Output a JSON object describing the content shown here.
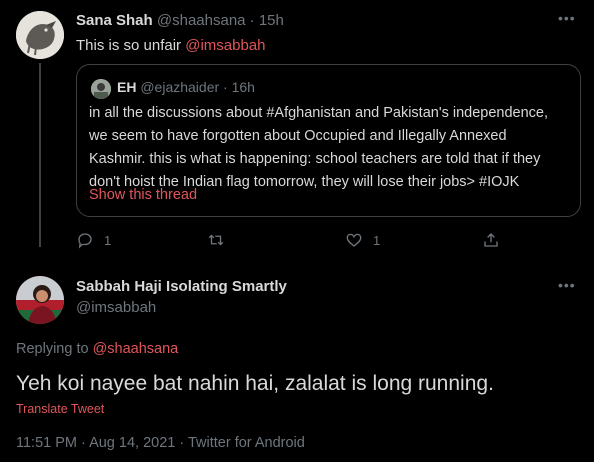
{
  "parent_tweet": {
    "author_name": "Sana Shah",
    "author_handle": "@shaahsana",
    "separator": "·",
    "time": "15h",
    "text_prefix": "This is so unfair ",
    "mention": "@imsabbah",
    "more_icon": "more-horizontal-icon",
    "quoted": {
      "author_name": "EH",
      "author_handle": "@ejazhaider",
      "time": "16h",
      "lines": [
        "in all the discussions about #Afghanistan and Pakistan's independence,",
        "we seem to have forgotten about Occupied and Illegally Annexed",
        "Kashmir. this is what is happening: school teachers are told that if they",
        "don't hoist the Indian flag tomorrow, they will lose their jobs> #IOJK"
      ],
      "show_thread_label": "Show this thread"
    },
    "actions": {
      "reply_count": "1",
      "retweet_count": "",
      "like_count": "1",
      "share_label": ""
    }
  },
  "main_tweet": {
    "author_name": "Sabbah Haji Isolating Smartly",
    "author_handle": "@imsabbah",
    "replying_to_prefix": "Replying to ",
    "replying_to_handle": "@shaahsana",
    "text": "Yeh koi nayee bat nahin hai, zalalat is long running.",
    "translate_label": "Translate Tweet",
    "meta": "11:51 PM · Aug 14, 2021 · Twitter for Android"
  },
  "colors": {
    "background": "#000000",
    "text": "#d9d9d9",
    "muted": "#6e767d",
    "accent": "#e0565b",
    "border": "#3d4145"
  }
}
